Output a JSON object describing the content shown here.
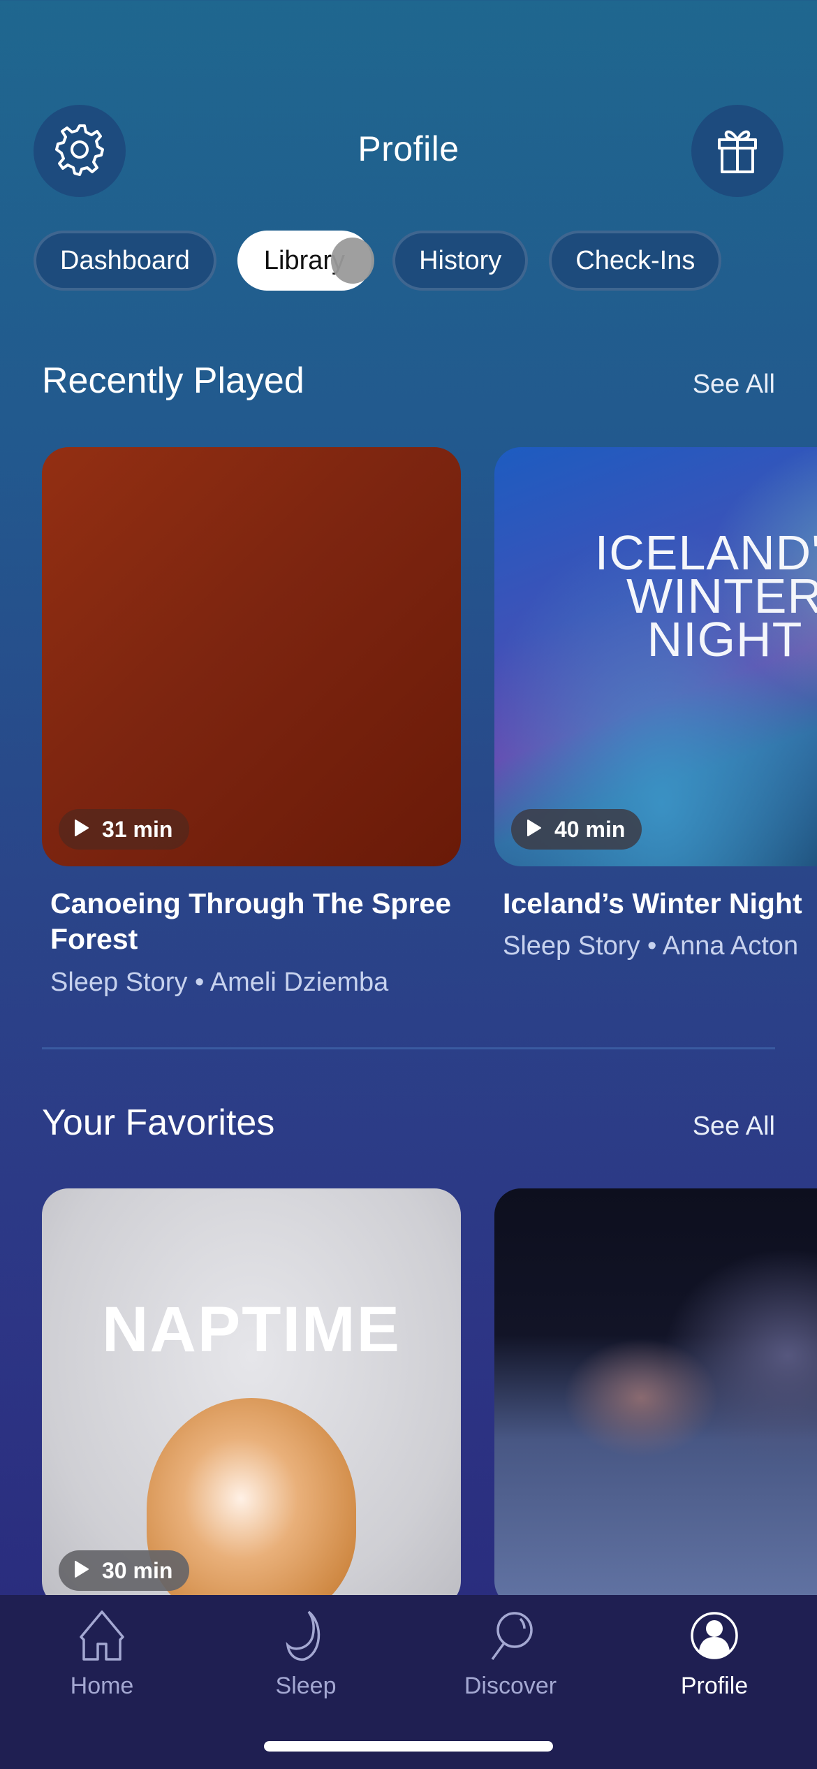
{
  "header": {
    "title": "Profile",
    "left_icon": "gear-icon",
    "right_icon": "gift-icon"
  },
  "tabs": [
    {
      "label": "Dashboard",
      "active": false
    },
    {
      "label": "Library",
      "active": true
    },
    {
      "label": "History",
      "active": false
    },
    {
      "label": "Check-Ins",
      "active": false
    }
  ],
  "recently_played": {
    "title": "Recently Played",
    "see_all": "See All",
    "items": [
      {
        "duration": "31 min",
        "title": "Canoeing Through The Spree Forest",
        "subtitle": "Sleep Story • Ameli Dziemba",
        "artwork_text": ""
      },
      {
        "duration": "40 min",
        "title": "Iceland’s Winter Night",
        "subtitle": "Sleep Story • Anna Acton",
        "artwork_text": "ICELAND'S WINTER NIGHT"
      }
    ]
  },
  "favorites": {
    "title": "Your Favorites",
    "see_all": "See All",
    "items": [
      {
        "duration": "30 min",
        "artwork_text": "NAPTIME"
      },
      {
        "duration": "",
        "artwork_text": ""
      }
    ]
  },
  "bottom_nav": [
    {
      "label": "Home",
      "icon": "home-icon",
      "active": false
    },
    {
      "label": "Sleep",
      "icon": "moon-icon",
      "active": false
    },
    {
      "label": "Discover",
      "icon": "search-icon",
      "active": false
    },
    {
      "label": "Profile",
      "icon": "profile-icon",
      "active": true
    }
  ],
  "colors": {
    "background_top": "#1f678f",
    "background_bottom": "#28287a",
    "tab_bar": "#1f1f52",
    "active_tab_bg": "#ffffff",
    "inactive_nav": "#a4a8d2"
  }
}
